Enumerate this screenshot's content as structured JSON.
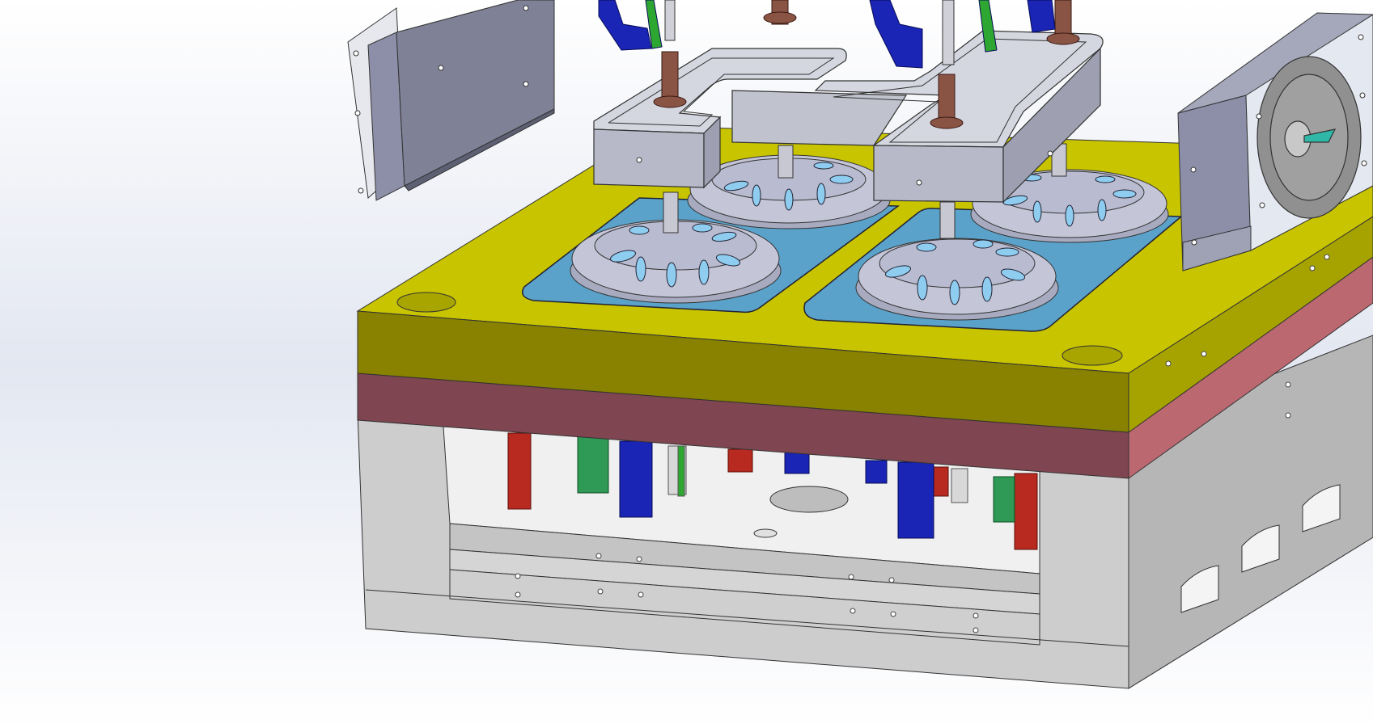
{
  "viewport": {
    "kind": "cad-3d-model-view",
    "text_visible": false,
    "background": {
      "top": "#ffffff",
      "middle": "#e3e7f1",
      "bottom": "#ffffff"
    }
  },
  "model": {
    "assembly": "injection-mold-assembly",
    "palette": {
      "cavity_plate": "#c8c400",
      "cavity_plate_front": "#888200",
      "cavity_plate_side": "#a6a300",
      "plate_stripe_front": "#7f4550",
      "plate_stripe_side": "#bb6870",
      "base_front": "#cdcdcd",
      "base_side": "#b6b6b6",
      "cavity_insert": "#5aa2ca",
      "molded_part": "#b9bbd0",
      "part_slot": "#8fcdf0",
      "manifold": "#b7b9c8",
      "nozzle": "#8a5445",
      "side_block": "#8d8fa8",
      "gear": "#909090",
      "spring_red": "#b82a20",
      "spring_green": "#2e9a55",
      "pin_blue": "#1a25b5",
      "ejector_green": "#2ea632"
    },
    "components": [
      {
        "name": "cavity-plate"
      },
      {
        "name": "clamp-plate-stripe"
      },
      {
        "name": "mold-base"
      },
      {
        "name": "cavity-insert-left"
      },
      {
        "name": "cavity-insert-right"
      },
      {
        "name": "molded-part",
        "count": 4,
        "slot_count": 10
      },
      {
        "name": "hot-runner-manifold"
      },
      {
        "name": "nozzle",
        "count": 4
      },
      {
        "name": "side-core-block-left"
      },
      {
        "name": "side-core-block-right"
      },
      {
        "name": "gear-drive"
      },
      {
        "name": "return-spring-red",
        "count": 4
      },
      {
        "name": "return-spring-green",
        "count": 2
      },
      {
        "name": "ejector-pin",
        "count": 2
      }
    ]
  }
}
